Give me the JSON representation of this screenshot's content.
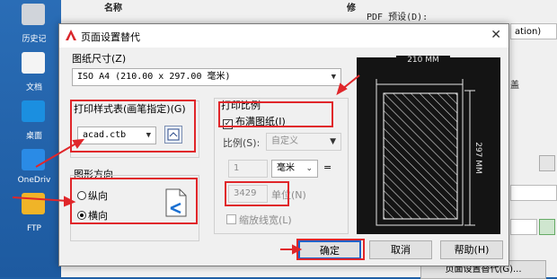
{
  "desktop": {
    "items": [
      {
        "label": "历史记"
      },
      {
        "label": "文档"
      },
      {
        "label": "桌面"
      },
      {
        "label": "OneDriv"
      },
      {
        "label": "FTP"
      }
    ]
  },
  "background_window": {
    "col_name": "名称",
    "col_mod": "修",
    "pdf_preset_label": "PDF 预设(D):",
    "right_field1": "ation)",
    "right_field2": "盖",
    "right_bottom_button": "页面设置替代(G)..."
  },
  "dialog": {
    "title": "页面设置替代",
    "paper_size_label": "图纸尺寸(Z)",
    "paper_size_value": "ISO A4 (210.00 x 297.00 毫米)",
    "plot_style_label": "打印样式表(画笔指定)(G)",
    "plot_style_value": "acad.ctb",
    "orientation_label": "图形方向",
    "portrait_label": "纵向",
    "landscape_label": "横向",
    "plot_scale_label": "打印比例",
    "fit_to_paper_label": "布满图纸(I)",
    "scale_label": "比例(S):",
    "scale_value": "自定义",
    "scale_num": "1",
    "unit_value": "毫米",
    "equals": "=",
    "scale_den": "3429",
    "unit_label": "单位(N)",
    "scale_lineweights_label": "缩放线宽(L)",
    "preview_width": "210 MM",
    "preview_height": "297 MM",
    "ok_label": "确定",
    "cancel_label": "取消",
    "help_label": "帮助(H)"
  },
  "colors": {
    "accent_red": "#e0262a",
    "desktop_blue": "#1f5fa6",
    "preview_bg": "#141414"
  }
}
